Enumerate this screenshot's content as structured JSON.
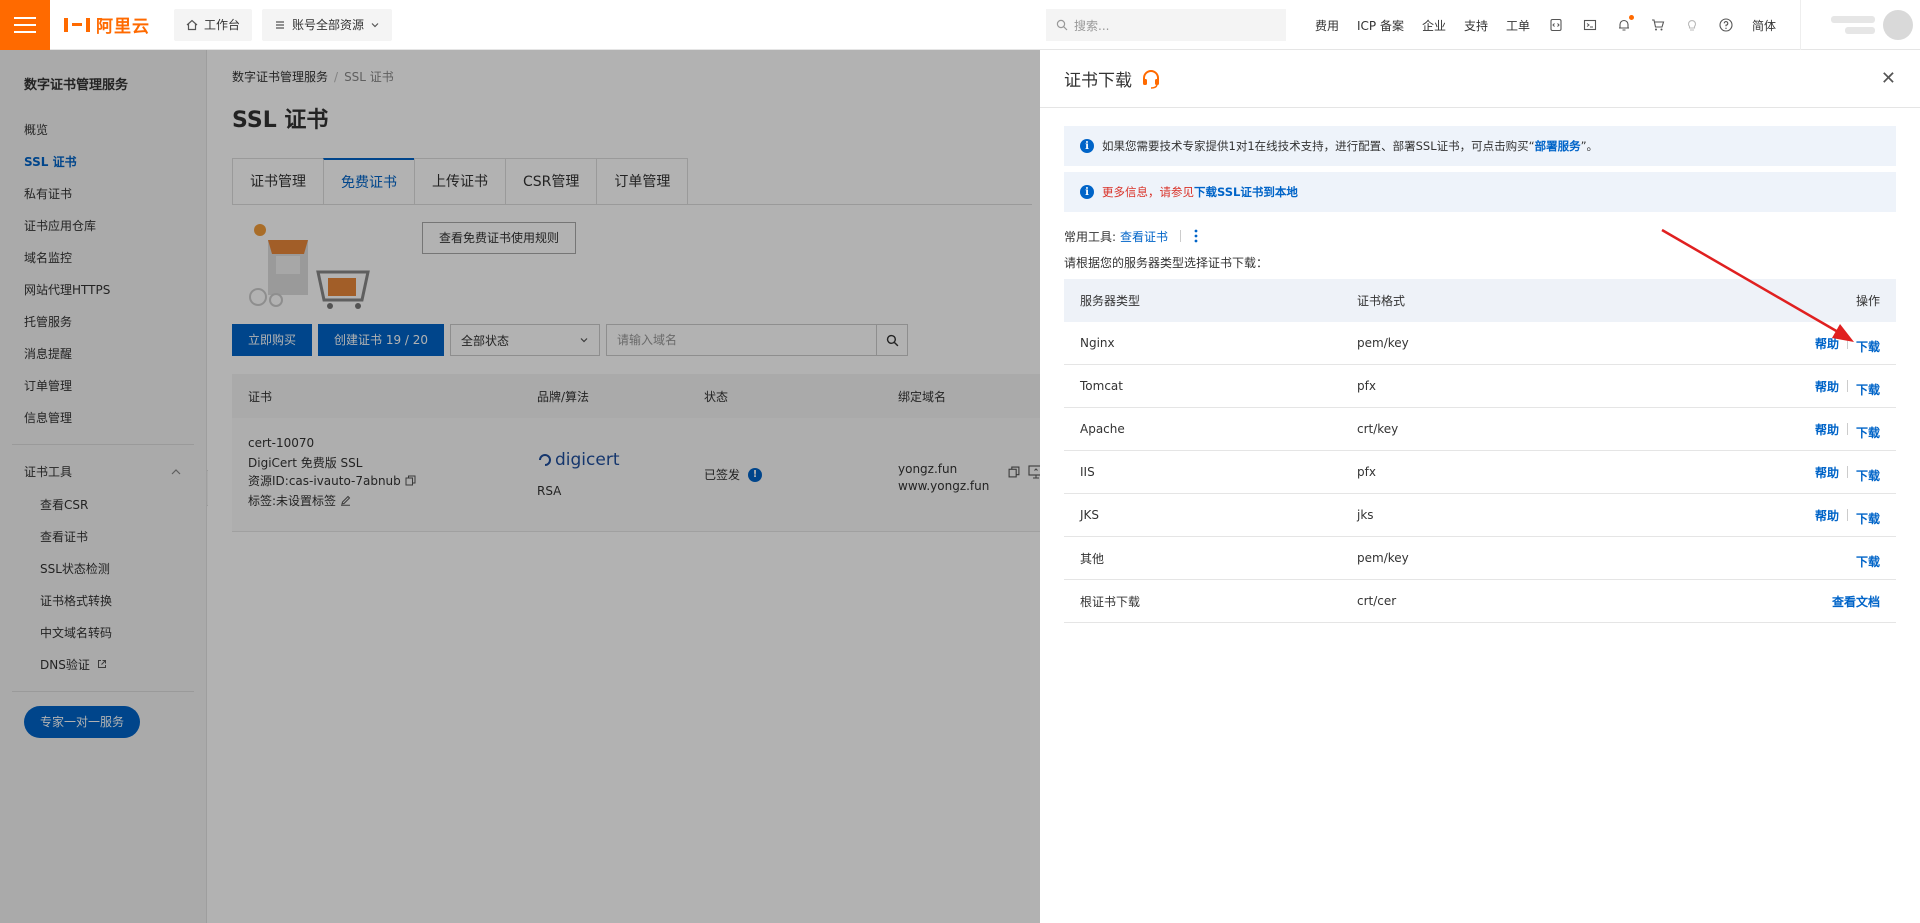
{
  "topbar": {
    "logo_text": "阿里云",
    "workbench": "工作台",
    "resources": "账号全部资源",
    "search_placeholder": "搜索...",
    "links": [
      "费用",
      "ICP 备案",
      "企业",
      "支持",
      "工单"
    ],
    "lang": "简体"
  },
  "sidebar": {
    "title": "数字证书管理服务",
    "items": [
      "概览",
      "SSL 证书",
      "私有证书",
      "证书应用仓库",
      "域名监控",
      "网站代理HTTPS",
      "托管服务",
      "消息提醒",
      "订单管理",
      "信息管理"
    ],
    "tools_group": "证书工具",
    "tools": [
      "查看CSR",
      "查看证书",
      "SSL状态检测",
      "证书格式转换",
      "中文域名转码",
      "DNS验证"
    ],
    "expert_button": "专家一对一服务"
  },
  "main": {
    "breadcrumb": [
      "数字证书管理服务",
      "SSL 证书"
    ],
    "title": "SSL 证书",
    "tabs": [
      "证书管理",
      "免费证书",
      "上传证书",
      "CSR管理",
      "订单管理"
    ],
    "rules_button": "查看免费证书使用规则",
    "buy_button": "立即购买",
    "create_button": "创建证书 19 / 20",
    "status_select": "全部状态",
    "domain_placeholder": "请输入域名",
    "columns": [
      "证书",
      "品牌/算法",
      "状态",
      "绑定域名"
    ],
    "row": {
      "cert_id": "cert-10070",
      "cert_name": "DigiCert 免费版 SSL",
      "resource_id": "资源ID:cas-ivauto-7abnub",
      "tag": "标签:未设置标签",
      "brand": "digicert",
      "algorithm": "RSA",
      "status": "已签发",
      "domain1": "yongz.fun",
      "domain2": "www.yongz.fun"
    }
  },
  "panel": {
    "title": "证书下载",
    "notice1_pre": "如果您需要技术专家提供1对1在线技术支持，进行配置、部署SSL证书，可点击购买“",
    "notice1_link": "部署服务",
    "notice1_post": "”。",
    "notice2_pre": "更多信息，请参见",
    "notice2_link": "下载SSL证书到本地",
    "tools_label": "常用工具:",
    "tools_link": "查看证书",
    "hint": "请根据您的服务器类型选择证书下载：",
    "columns": {
      "server": "服务器类型",
      "format": "证书格式",
      "ops": "操作"
    },
    "help_label": "帮助",
    "download_label": "下载",
    "rows": [
      {
        "server": "Nginx",
        "format": "pem/key"
      },
      {
        "server": "Tomcat",
        "format": "pfx"
      },
      {
        "server": "Apache",
        "format": "crt/key"
      },
      {
        "server": "IIS",
        "format": "pfx"
      },
      {
        "server": "JKS",
        "format": "jks"
      },
      {
        "server": "其他",
        "format": "pem/key"
      },
      {
        "server": "根证书下载",
        "format": "crt/cer",
        "op": "查看文档"
      }
    ]
  },
  "colors": {
    "accent": "#0064c8",
    "brand": "#ff6a00",
    "arrow": "#e02020",
    "danger": "#d93026"
  }
}
